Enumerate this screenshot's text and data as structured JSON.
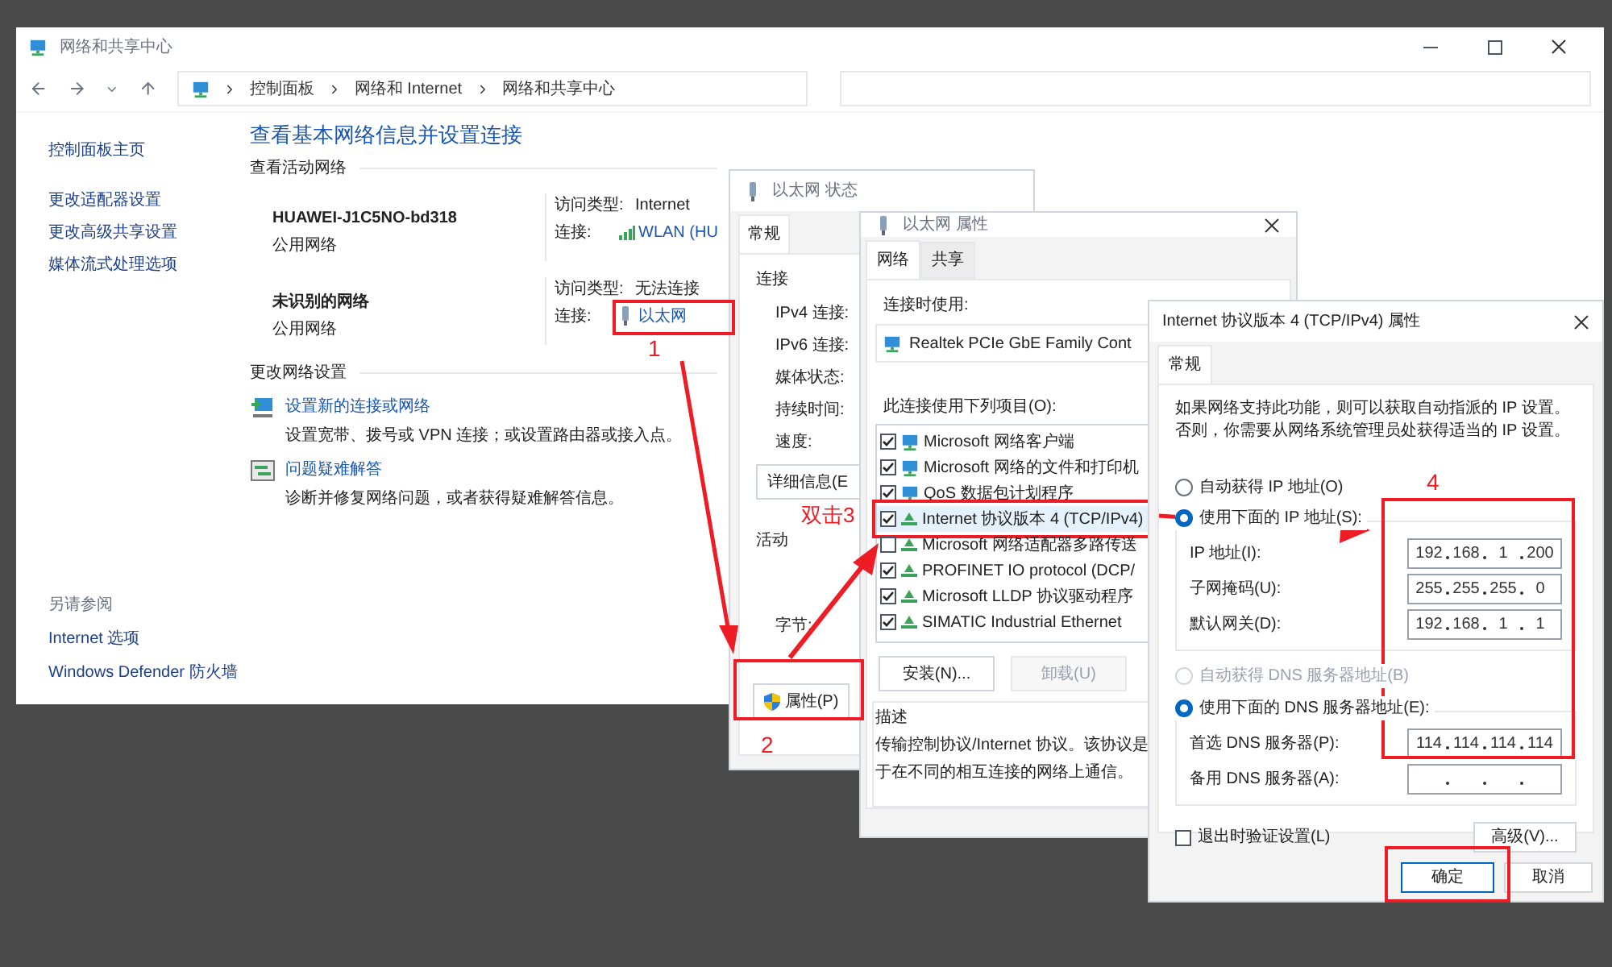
{
  "main_window": {
    "title": "网络和共享中心",
    "breadcrumb": [
      "控制面板",
      "网络和 Internet",
      "网络和共享中心"
    ],
    "sidebar": {
      "items": [
        "控制面板主页",
        "更改适配器设置",
        "更改高级共享设置",
        "媒体流式处理选项"
      ],
      "see_also_title": "另请参阅",
      "see_also": [
        "Internet 选项",
        "Windows Defender 防火墙"
      ]
    },
    "heading": "查看基本网络信息并设置连接",
    "active_networks": {
      "title": "查看活动网络",
      "networks": [
        {
          "name": "HUAWEI-J1C5NO-bd318",
          "type": "公用网络",
          "access_label": "访问类型:",
          "access": "Internet",
          "connection_label": "连接:",
          "connection": "WLAN (HU",
          "kind": "wifi"
        },
        {
          "name": "未识别的网络",
          "type": "公用网络",
          "access_label": "访问类型:",
          "access": "无法连接",
          "connection_label": "连接:",
          "connection": "以太网",
          "kind": "ethernet"
        }
      ]
    },
    "change_settings": {
      "title": "更改网络设置",
      "items": [
        {
          "kind": "new-connection",
          "link": "设置新的连接或网络",
          "description": "设置宽带、拨号或 VPN 连接；或设置路由器或接入点。"
        },
        {
          "kind": "troubleshoot",
          "link": "问题疑难解答",
          "description": "诊断并修复网络问题，或者获得疑难解答信息。"
        }
      ]
    }
  },
  "status_dialog": {
    "title": "以太网 状态",
    "tab": "常规",
    "connection_group": "连接",
    "fields": [
      "IPv4 连接:",
      "IPv6 连接:",
      "媒体状态:",
      "持续时间:",
      "速度:"
    ],
    "details_button": "详细信息(E",
    "activity_group": "活动",
    "bytes_label": "字节:",
    "properties_button": "属性(P)"
  },
  "properties_dialog": {
    "title": "以太网 属性",
    "tabs": [
      {
        "label": "网络",
        "selected": true
      },
      {
        "label": "共享",
        "selected": false
      }
    ],
    "connect_using_label": "连接时使用:",
    "adapter": "Realtek PCIe GbE Family Cont",
    "items_label": "此连接使用下列项目(O):",
    "items": [
      {
        "label": "Microsoft 网络客户端",
        "checked": true,
        "selected": false,
        "kind": "monitor"
      },
      {
        "label": "Microsoft 网络的文件和打印机",
        "checked": true,
        "selected": false,
        "kind": "monitor"
      },
      {
        "label": "QoS 数据包计划程序",
        "checked": true,
        "selected": false,
        "kind": "monitor"
      },
      {
        "label": "Internet 协议版本 4 (TCP/IPv4)",
        "checked": true,
        "selected": true,
        "kind": "protocol"
      },
      {
        "label": "Microsoft 网络适配器多路传送",
        "checked": false,
        "selected": false,
        "kind": "protocol"
      },
      {
        "label": "PROFINET IO protocol (DCP/",
        "checked": true,
        "selected": false,
        "kind": "protocol"
      },
      {
        "label": "Microsoft LLDP 协议驱动程序",
        "checked": true,
        "selected": false,
        "kind": "protocol"
      },
      {
        "label": "SIMATIC Industrial Ethernet",
        "checked": true,
        "selected": false,
        "kind": "protocol"
      }
    ],
    "install_button": "安装(N)...",
    "uninstall_button": {
      "label": "卸载(U)",
      "disabled": true
    },
    "description_group": "描述",
    "description_lines": [
      "传输控制协议/Internet 协议。该协议是",
      "于在不同的相互连接的网络上通信。"
    ]
  },
  "ipv4_dialog": {
    "title": "Internet 协议版本 4 (TCP/IPv4) 属性",
    "tab": "常规",
    "intro": "如果网络支持此功能，则可以获取自动指派的 IP 设置。否则，你需要从网络系统管理员处获得适当的 IP 设置。",
    "ip_mode": [
      {
        "label": "自动获得 IP 地址(O)",
        "selected": false
      },
      {
        "label": "使用下面的 IP 地址(S):",
        "selected": true
      }
    ],
    "ip_fields": [
      {
        "label": "IP 地址(I):",
        "octets": [
          "192",
          "168",
          "1",
          "200"
        ]
      },
      {
        "label": "子网掩码(U):",
        "octets": [
          "255",
          "255",
          "255",
          "0"
        ]
      },
      {
        "label": "默认网关(D):",
        "octets": [
          "192",
          "168",
          "1",
          "1"
        ]
      }
    ],
    "dns_mode": [
      {
        "label": "自动获得 DNS 服务器地址(B)",
        "selected": false,
        "disabled": true
      },
      {
        "label": "使用下面的 DNS 服务器地址(E):",
        "selected": true,
        "disabled": false
      }
    ],
    "dns_fields": [
      {
        "label": "首选 DNS 服务器(P):",
        "octets": [
          "114",
          "114",
          "114",
          "114"
        ]
      },
      {
        "label": "备用 DNS 服务器(A):"
      }
    ],
    "validate": {
      "label": "退出时验证设置(L)",
      "checked": false
    },
    "advanced_button": "高级(V)...",
    "ok_button": "确定",
    "cancel_button": "取消"
  },
  "annotations": {
    "step_1": "1",
    "step_2": "2",
    "step_3": "双击3",
    "step_4": "4"
  }
}
